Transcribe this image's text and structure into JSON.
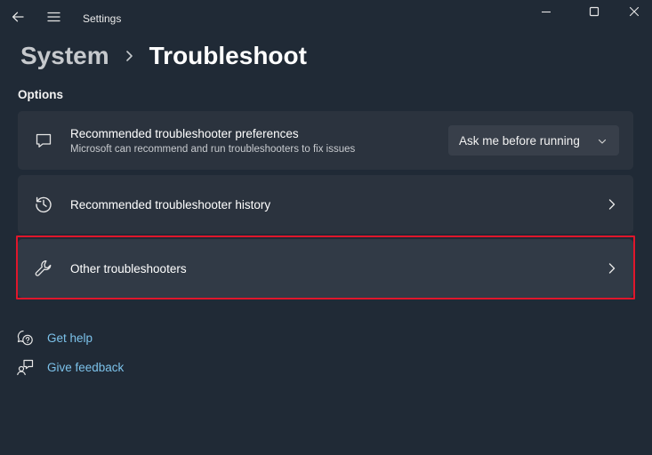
{
  "window": {
    "title": "Settings"
  },
  "breadcrumb": {
    "parent": "System",
    "current": "Troubleshoot"
  },
  "section": {
    "label": "Options"
  },
  "cards": [
    {
      "title": "Recommended troubleshooter preferences",
      "subtitle": "Microsoft can recommend and run troubleshooters to fix issues",
      "icon": "chat-bubble-icon",
      "dropdown_value": "Ask me before running"
    },
    {
      "title": "Recommended troubleshooter history",
      "icon": "history-icon"
    },
    {
      "title": "Other troubleshooters",
      "icon": "wrench-icon",
      "highlighted": true
    }
  ],
  "links": [
    {
      "label": "Get help",
      "icon": "help-icon"
    },
    {
      "label": "Give feedback",
      "icon": "feedback-icon"
    }
  ],
  "colors": {
    "background": "#202a36",
    "card": "#2b333e",
    "link": "#7cc2ea",
    "highlight": "#e0162b"
  }
}
